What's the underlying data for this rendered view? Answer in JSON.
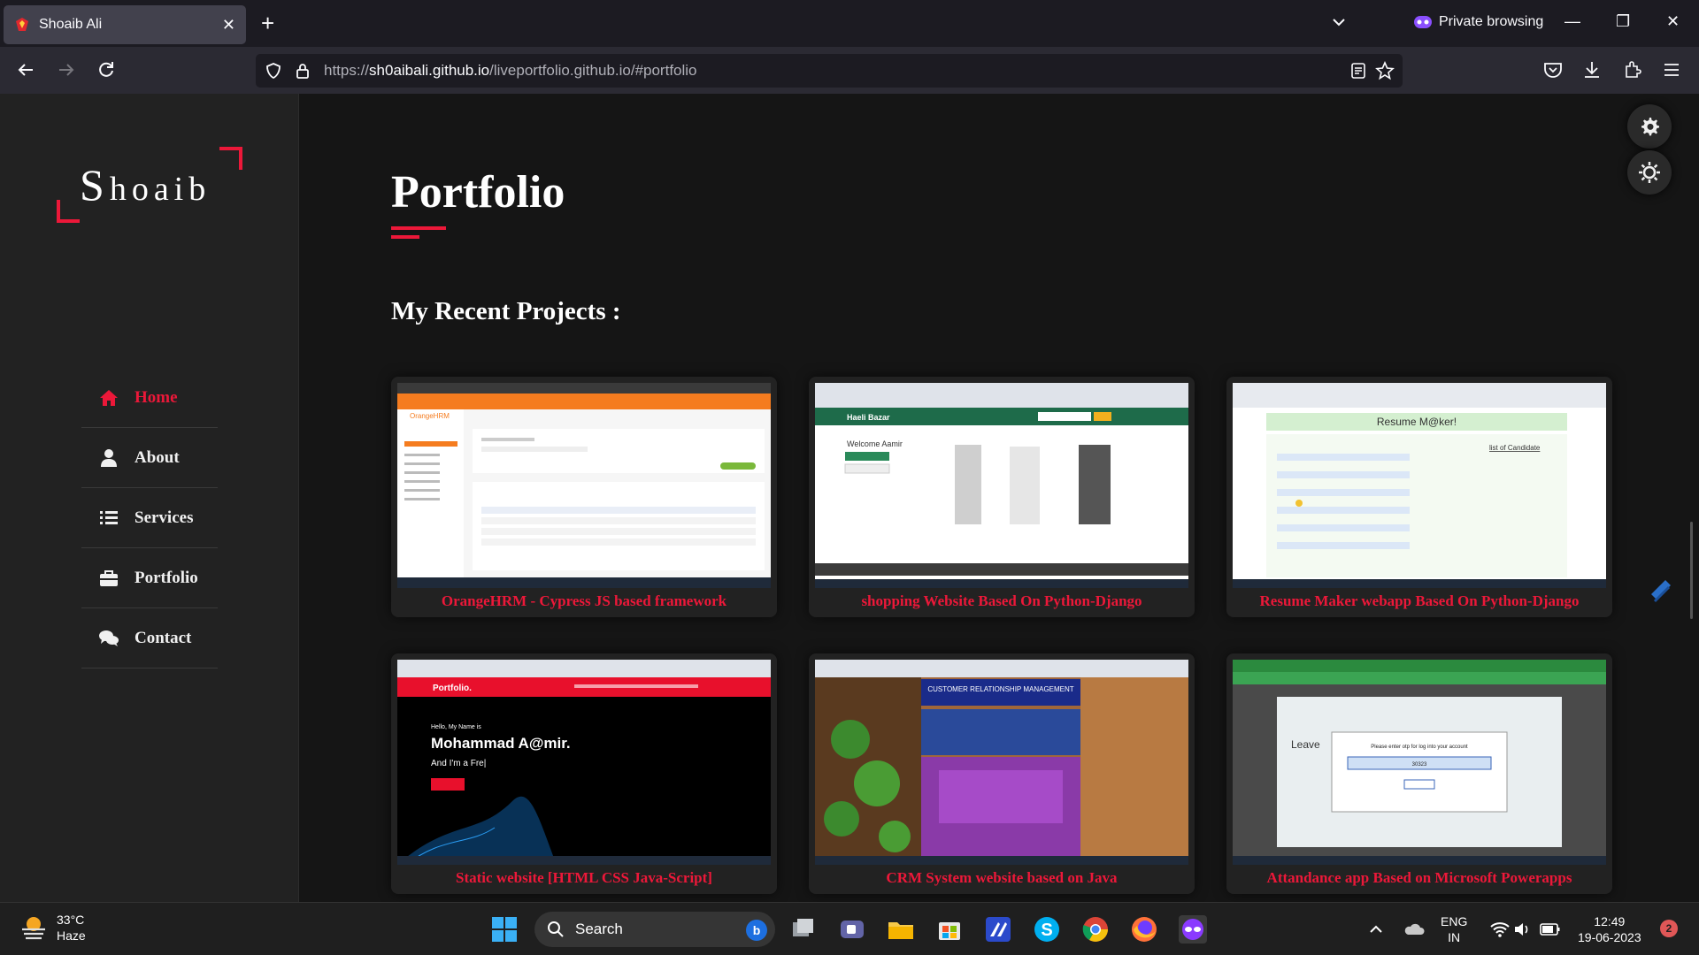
{
  "browser": {
    "tab_title": "Shoaib Ali",
    "url_prefix": "https://",
    "url_host": "sh0aibali.github.io",
    "url_path": "/liveportfolio.github.io/#portfolio",
    "private_label": "Private browsing"
  },
  "sidebar": {
    "logo_initial": "S",
    "logo_rest": "hoaib",
    "items": [
      {
        "label": "Home",
        "icon": "home-icon",
        "active": true
      },
      {
        "label": "About",
        "icon": "user-icon"
      },
      {
        "label": "Services",
        "icon": "list-icon"
      },
      {
        "label": "Portfolio",
        "icon": "briefcase-icon"
      },
      {
        "label": "Contact",
        "icon": "comments-icon"
      }
    ]
  },
  "main": {
    "title": "Portfolio",
    "subtitle": "My Recent Projects :",
    "projects": [
      {
        "caption": "OrangeHRM - Cypress JS based framework",
        "thumb_text": "OrangeHRM"
      },
      {
        "caption": "shopping Website Based On Python-Django",
        "thumb_text": "Haeli Bazar",
        "thumb_text2": "Welcome Aamir"
      },
      {
        "caption": "Resume Maker webapp Based On Python-Django",
        "thumb_text": "Resume M@ker!",
        "thumb_text2": "list of Candidate"
      },
      {
        "caption": "Static website [HTML CSS Java-Script]",
        "thumb_text": "Portfolio.",
        "thumb_text2": "Hello, My Name is",
        "thumb_text3": "Mohammad A@mir.",
        "thumb_text4": "And I'm a Fre|"
      },
      {
        "caption": "CRM System website based on Java",
        "thumb_text": "CUSTOMER RELATIONSHIP MANAGEMENT"
      },
      {
        "caption": "Attandance app Based on Microsoft Powerapps",
        "thumb_text": "Please enter otp for log into your account",
        "thumb_text2": "Leave",
        "thumb_text3": "30323"
      }
    ]
  },
  "taskbar": {
    "weather_temp": "33°C",
    "weather_desc": "Haze",
    "search_placeholder": "Search",
    "lang_line1": "ENG",
    "lang_line2": "IN",
    "time": "12:49",
    "date": "19-06-2023",
    "notification_count": "2"
  },
  "colors": {
    "accent": "#ec1839",
    "sidebar_bg": "#222222",
    "page_bg": "#151515"
  }
}
